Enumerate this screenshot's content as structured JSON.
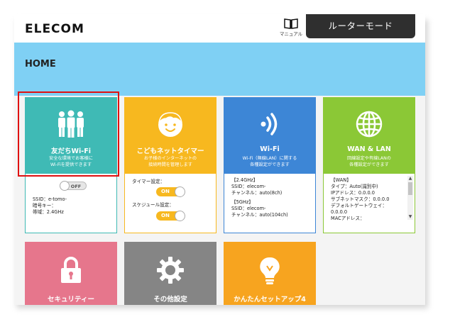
{
  "header": {
    "logo": "ELECOM",
    "manual_label": "マニュアル",
    "mode_label": "ルーターモード"
  },
  "page": {
    "title": "HOME"
  },
  "cards": {
    "friend_wifi": {
      "title": "友だちWi-Fi",
      "desc1": "安全な環境でお客様に",
      "desc2": "Wi-Fiを提供できます",
      "toggle": "OFF",
      "ssid": "SSID：e-tomo-",
      "key": "暗号キー：",
      "band": "帯域：2.4GHz"
    },
    "kids_timer": {
      "title": "こどもネットタイマー",
      "desc1": "お子様のインターネットの",
      "desc2": "接続時間を管理します",
      "timer_label": "タイマー設定：",
      "timer_value": "ON",
      "schedule_label": "スケジュール設定：",
      "schedule_value": "ON"
    },
    "wifi": {
      "title": "Wi-Fi",
      "desc1": "Wi-Fi（無線LAN）に関する",
      "desc2": "各種設定ができます",
      "band24": "【2.4GHz】",
      "ssid24": "SSID：elecom-",
      "ch24": "チャンネル：auto(8ch)",
      "band5": "【5GHz】",
      "ssid5": "SSID：elecom-",
      "ch5": "チャンネル：auto(104ch)"
    },
    "wan_lan": {
      "title": "WAN & LAN",
      "desc1": "回線設定や有線LANの",
      "desc2": "各種設定ができます",
      "wan": "【WAN】",
      "type": "タイプ：Auto(識別中)",
      "ip": "IPアドレス：0.0.0.0",
      "subnet": "サブネットマスク：0.0.0.0",
      "gateway1": "デフォルトゲートウェイ：",
      "gateway2": "0.0.0.0",
      "mac": "MACアドレス："
    },
    "security": {
      "title": "セキュリティー"
    },
    "other": {
      "title": "その他設定"
    },
    "setup": {
      "title": "かんたんセットアップ4"
    }
  },
  "colors": {
    "header_band": "#7fd0f4",
    "teal": "#3fbab5",
    "orange": "#f7b81f",
    "blue": "#3d86d6",
    "green": "#8bc836",
    "pink": "#e6768c",
    "gray": "#858585",
    "amber": "#f7a41f",
    "highlight": "#e01010"
  }
}
